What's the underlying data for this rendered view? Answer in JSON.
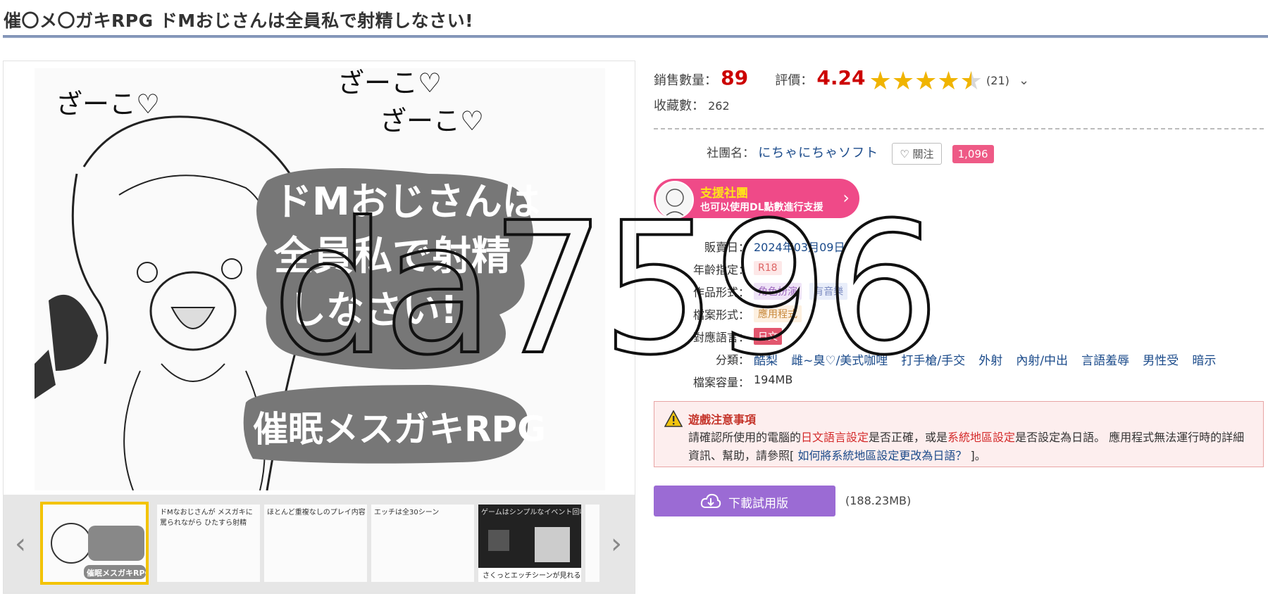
{
  "page": {
    "title": "催〇メ〇ガキRPG ドMおじさんは全員私で射精しなさい!"
  },
  "gallery": {
    "main_text_1": "ざーこ♡",
    "main_text_2": "ざーこ♡",
    "main_text_3": "ざーこ♡",
    "cover_line_1": "ドMおじさんは",
    "cover_line_2": "全員私で射精",
    "cover_line_3": "しなさい!",
    "cover_subtitle": "催眠メスガキRPG",
    "thumbnails": [
      {
        "caption": "",
        "selected": true
      },
      {
        "caption": "ドMなおじさんが メスガキに罵られながら ひたすら射精",
        "selected": false
      },
      {
        "caption": "ほとんど重複なしのプレイ内容",
        "selected": false
      },
      {
        "caption": "エッチは全30シーン",
        "selected": false
      },
      {
        "caption": "ゲームはシンプルなイベント回収型",
        "selected": false
      }
    ],
    "thumb0_caption": "催眠メスガキRPG",
    "thumb4_bottom": "さくっとエッチシーンが見れる!"
  },
  "stats": {
    "sales_label": "銷售數量：",
    "sales_value": "89",
    "rating_label": "評價：",
    "rating_value": "4.24",
    "rating_count": "(21)",
    "favorites_label": "收藏數：",
    "favorites_value": "262"
  },
  "circle": {
    "label": "社團名：",
    "name": "にちゃにちゃソフト",
    "follow_label": "關注",
    "follow_count": "1,096"
  },
  "support": {
    "title": "支援社團",
    "subtitle": "也可以使用DL點數進行支援"
  },
  "specs": {
    "release_label": "販賣日：",
    "release_value": "2024年03月09日",
    "age_label": "年齡指定：",
    "age_value": "R18",
    "format_label": "作品形式：",
    "format_tags": [
      "角色扮演",
      "有音樂"
    ],
    "filetype_label": "檔案形式：",
    "filetype_value": "應用程式",
    "language_label": "對應語言：",
    "language_value": "日文",
    "genre_label": "分類：",
    "genres": [
      "酷梨",
      "雌~臭♡/美式咖哩",
      "打手槍/手交",
      "外射",
      "內射/中出",
      "言語羞辱",
      "男性受",
      "暗示"
    ],
    "size_label": "檔案容量：",
    "size_value": "194MB"
  },
  "warning": {
    "title": "遊戲注意事項",
    "body_1": "請確認所使用的電腦的",
    "body_red_1": "日文語言設定",
    "body_2": "是否正確，或是",
    "body_red_2": "系統地區設定",
    "body_3": "是否設定為日語。 應用程式無法運行時的詳細資訊、幫助，請參照[ ",
    "body_link": "如何將系統地區設定更改為日語？",
    "body_4": " ]。"
  },
  "download": {
    "label": "下載試用版",
    "size": "(188.23MB)"
  },
  "watermark": "da7596",
  "colors": {
    "accent_red": "#cc0000",
    "star": "#f0b400",
    "link": "#1a4a8a",
    "download": "#9b6bd4",
    "support": "#ef4a88"
  }
}
